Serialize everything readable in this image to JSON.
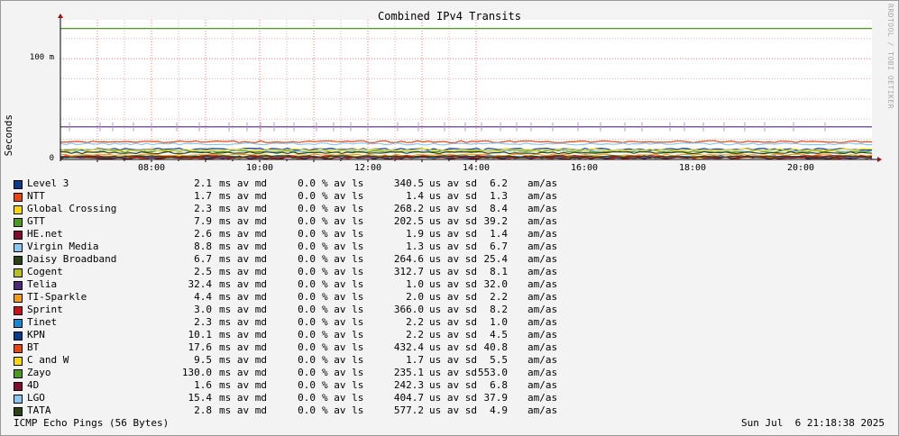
{
  "title": "Combined IPv4 Transits",
  "watermark": "RRDTOOL / TOBI OETIKER",
  "ylabel": "Seconds",
  "footer_left": "ICMP Echo Pings (56 Bytes)",
  "footer_right": "Sun Jul  6 21:18:38 2025",
  "colors": {
    "grid_major": "#ff6e6e",
    "grid_minor": "#e8b0b0",
    "axis": "#000000",
    "background": "#f3f3f3",
    "canvas": "#ffffff"
  },
  "chart_data": {
    "type": "line",
    "title": "Combined IPv4 Transits",
    "xlabel": "",
    "ylabel": "Seconds",
    "x_ticks": [
      "08:00",
      "10:00",
      "12:00",
      "14:00",
      "16:00",
      "18:00",
      "20:00"
    ],
    "y_ticks": [
      "0",
      "100 m"
    ],
    "ylim": [
      0,
      0.135
    ],
    "grid": true,
    "legend": "bottom",
    "series": [
      {
        "name": "Level 3",
        "color": "#0b3a8a",
        "value": 0.0021
      },
      {
        "name": "NTT",
        "color": "#ea4410",
        "value": 0.0017
      },
      {
        "name": "Global Crossing",
        "color": "#f6d60f",
        "value": 0.0023
      },
      {
        "name": "GTT",
        "color": "#4c9a21",
        "value": 0.0079
      },
      {
        "name": "HE.net",
        "color": "#7e0e2c",
        "value": 0.0026
      },
      {
        "name": "Virgin Media",
        "color": "#88c8f0",
        "value": 0.0088
      },
      {
        "name": "Daisy Broadband",
        "color": "#2c4413",
        "value": 0.0067
      },
      {
        "name": "Cogent",
        "color": "#b6c21b",
        "value": 0.0025
      },
      {
        "name": "Telia",
        "color": "#4d2a78",
        "value": 0.0324
      },
      {
        "name": "TI-Sparkle",
        "color": "#f29a1c",
        "value": 0.0044
      },
      {
        "name": "Sprint",
        "color": "#c8121a",
        "value": 0.003
      },
      {
        "name": "Tinet",
        "color": "#1a86d0",
        "value": 0.0023
      },
      {
        "name": "KPN",
        "color": "#0b3a8a",
        "value": 0.0101
      },
      {
        "name": "BT",
        "color": "#ea4410",
        "value": 0.0176
      },
      {
        "name": "C and W",
        "color": "#f6d60f",
        "value": 0.0095
      },
      {
        "name": "Zayo",
        "color": "#4c9a21",
        "value": 0.13
      },
      {
        "name": "4D",
        "color": "#7e0e2c",
        "value": 0.0016
      },
      {
        "name": "LGO",
        "color": "#88c8f0",
        "value": 0.0154
      },
      {
        "name": "TATA",
        "color": "#2c4413",
        "value": 0.0028
      }
    ]
  },
  "legend_rows": [
    {
      "name": "Level 3",
      "avmd": "2.1",
      "avls": "0.0",
      "avsd": "340.5",
      "amas": "6.2"
    },
    {
      "name": "NTT",
      "avmd": "1.7",
      "avls": "0.0",
      "avsd": "1.4",
      "amas": "1.3"
    },
    {
      "name": "Global Crossing",
      "avmd": "2.3",
      "avls": "0.0",
      "avsd": "268.2",
      "amas": "8.4"
    },
    {
      "name": "GTT",
      "avmd": "7.9",
      "avls": "0.0",
      "avsd": "202.5",
      "amas": "39.2"
    },
    {
      "name": "HE.net",
      "avmd": "2.6",
      "avls": "0.0",
      "avsd": "1.9",
      "amas": "1.4"
    },
    {
      "name": "Virgin Media",
      "avmd": "8.8",
      "avls": "0.0",
      "avsd": "1.3",
      "amas": "6.7"
    },
    {
      "name": "Daisy Broadband",
      "avmd": "6.7",
      "avls": "0.0",
      "avsd": "264.6",
      "amas": "25.4"
    },
    {
      "name": "Cogent",
      "avmd": "2.5",
      "avls": "0.0",
      "avsd": "312.7",
      "amas": "8.1"
    },
    {
      "name": "Telia",
      "avmd": "32.4",
      "avls": "0.0",
      "avsd": "1.0",
      "amas": "32.0"
    },
    {
      "name": "TI-Sparkle",
      "avmd": "4.4",
      "avls": "0.0",
      "avsd": "2.0",
      "amas": "2.2"
    },
    {
      "name": "Sprint",
      "avmd": "3.0",
      "avls": "0.0",
      "avsd": "366.0",
      "amas": "8.2"
    },
    {
      "name": "Tinet",
      "avmd": "2.3",
      "avls": "0.0",
      "avsd": "2.2",
      "amas": "1.0"
    },
    {
      "name": "KPN",
      "avmd": "10.1",
      "avls": "0.0",
      "avsd": "2.2",
      "amas": "4.5"
    },
    {
      "name": "BT",
      "avmd": "17.6",
      "avls": "0.0",
      "avsd": "432.4",
      "amas": "40.8"
    },
    {
      "name": "C and W",
      "avmd": "9.5",
      "avls": "0.0",
      "avsd": "1.7",
      "amas": "5.5"
    },
    {
      "name": "Zayo",
      "avmd": "130.0",
      "avls": "0.0",
      "avsd": "235.1",
      "amas": "553.0"
    },
    {
      "name": "4D",
      "avmd": "1.6",
      "avls": "0.0",
      "avsd": "242.3",
      "amas": "6.8"
    },
    {
      "name": "LGO",
      "avmd": "15.4",
      "avls": "0.0",
      "avsd": "404.7",
      "amas": "37.9"
    },
    {
      "name": "TATA",
      "avmd": "2.8",
      "avls": "0.0",
      "avsd": "577.2",
      "amas": "4.9"
    }
  ],
  "units": {
    "avmd": "ms av md",
    "avls": "% av ls",
    "avsd": "us av sd",
    "amas": "am/as"
  }
}
